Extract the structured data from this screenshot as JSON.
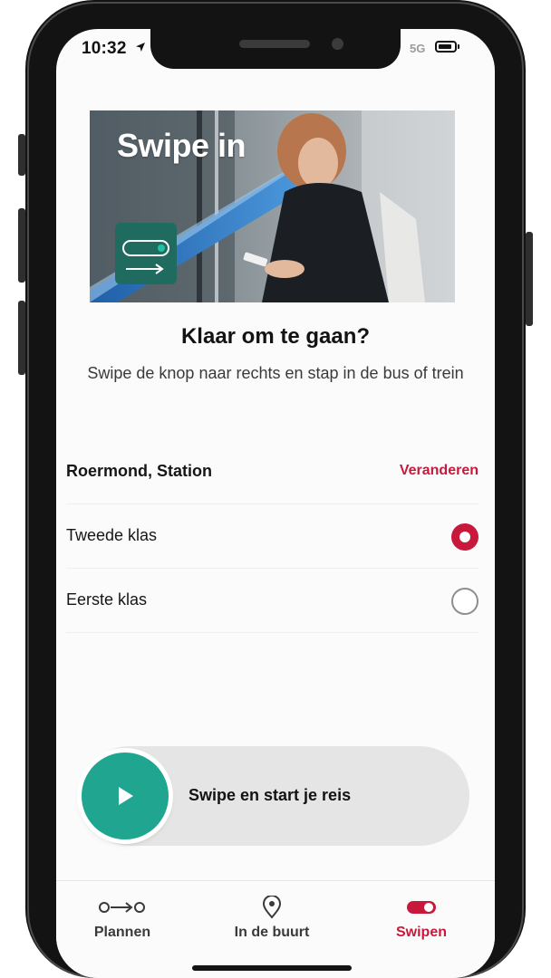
{
  "status_bar": {
    "time": "10:32",
    "network": "5G"
  },
  "hero": {
    "text": "Swipe in"
  },
  "content": {
    "title": "Klaar om te gaan?",
    "subtitle": "Swipe de knop naar rechts en stap in de bus of trein"
  },
  "location": {
    "name": "Roermond, Station",
    "change_label": "Veranderen"
  },
  "classes": [
    {
      "label": "Tweede klas",
      "selected": true
    },
    {
      "label": "Eerste klas",
      "selected": false
    }
  ],
  "swipe": {
    "label": "Swipe en start je reis"
  },
  "tabs": [
    {
      "label": "Plannen",
      "icon": "route-icon"
    },
    {
      "label": "In de buurt",
      "icon": "location-pin-icon"
    },
    {
      "label": "Swipen",
      "icon": "toggle-icon",
      "active": true
    }
  ],
  "colors": {
    "accent": "#c8193c",
    "teal": "#20a590"
  }
}
